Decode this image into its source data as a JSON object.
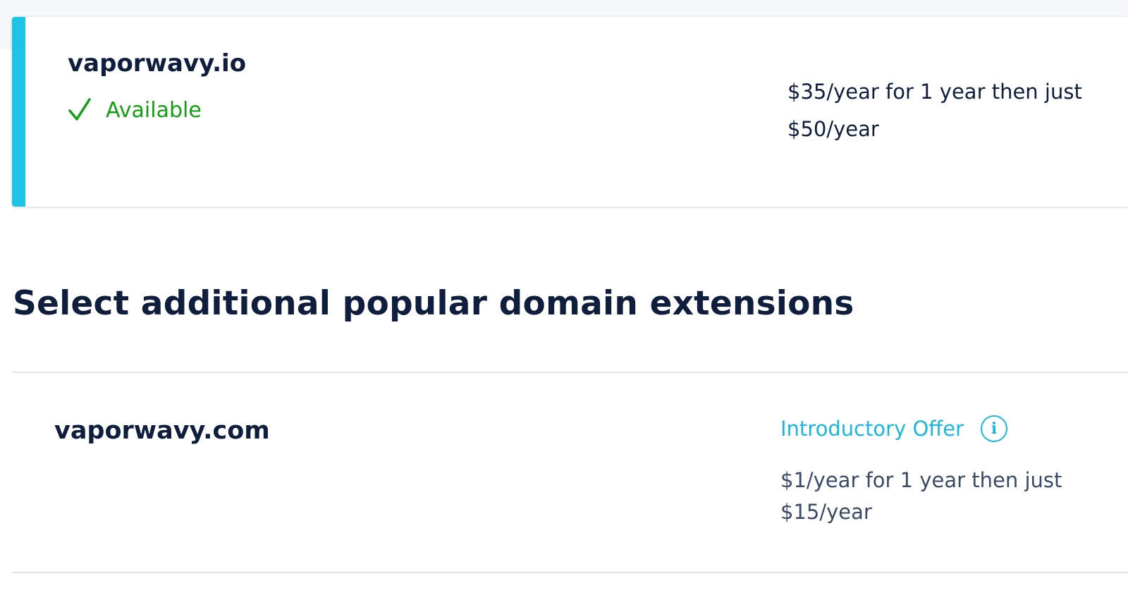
{
  "search_result": {
    "domain": "vaporwavy.io",
    "status_icon": "checkmark-icon",
    "status_text": "Available",
    "price_text": "$35/year for 1 year then just $50/year",
    "accent_color": "#1cc4e6",
    "status_color": "#14a014"
  },
  "section": {
    "title": "Select additional popular domain extensions"
  },
  "extensions": [
    {
      "domain": "vaporwavy.com",
      "offer_label": "Introductory Offer",
      "offer_icon": "info-icon",
      "offer_icon_glyph": "i",
      "price_text": "$1/year for 1 year then just $15/year",
      "offer_color": "#1ab7dc"
    }
  ]
}
